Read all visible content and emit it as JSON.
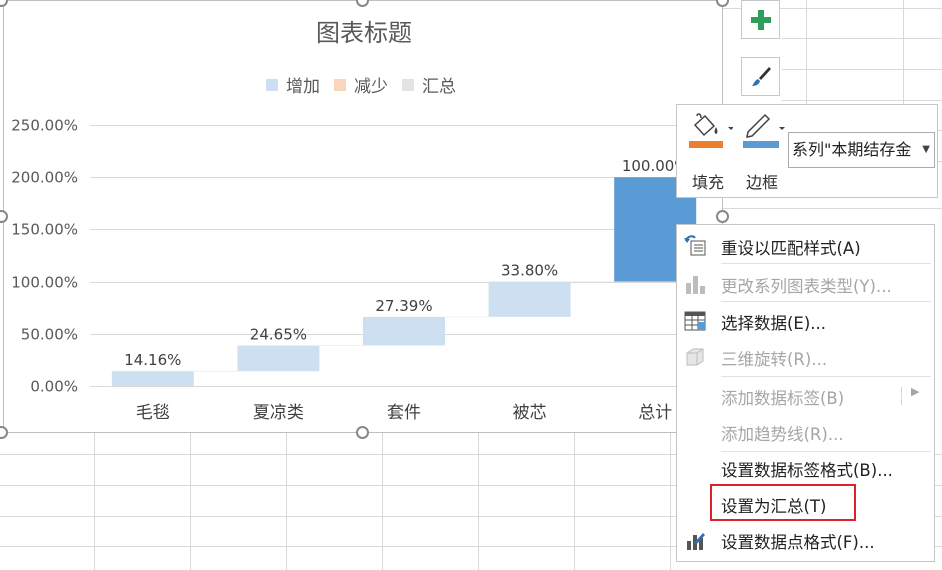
{
  "chart_data": {
    "type": "bar",
    "title": "图表标题",
    "legend": {
      "position": "top",
      "entries": [
        {
          "name": "增加",
          "color": "#CCE0F2"
        },
        {
          "name": "减少",
          "color": "#FAD5BE"
        },
        {
          "name": "汇总",
          "color": "#E3E3E3"
        }
      ]
    },
    "categories": [
      "毛毯",
      "夏凉类",
      "套件",
      "被芯",
      "总计"
    ],
    "series": [
      {
        "name": "增加",
        "bases": [
          0,
          14.16,
          38.81,
          66.2,
          0
        ],
        "values": [
          14.16,
          24.65,
          27.39,
          33.8,
          0
        ]
      },
      {
        "name": "汇总",
        "bases": [
          0,
          0,
          0,
          0,
          100
        ],
        "values": [
          0,
          0,
          0,
          0,
          100
        ]
      }
    ],
    "data_labels": [
      "14.16%",
      "24.65%",
      "27.39%",
      "33.80%",
      "100.00%"
    ],
    "y_ticks": [
      "0.00%",
      "50.00%",
      "100.00%",
      "150.00%",
      "200.00%",
      "250.00%"
    ],
    "ylim": [
      0,
      250
    ],
    "grid": true,
    "colors": {
      "increase": "#CCE0F2",
      "total_selected": "#5B9BD5"
    }
  },
  "mini_toolbar": {
    "fill_label": "填充",
    "border_label": "边框",
    "series_select_value": "系列\"本期结存金"
  },
  "side_buttons": {
    "add_icon": "plus-icon",
    "style_icon": "paintbrush-icon"
  },
  "context_menu": {
    "items": [
      {
        "label": "重设以匹配样式(A)",
        "enabled": true,
        "icon": "reset-style-icon"
      },
      {
        "label": "更改系列图表类型(Y)...",
        "enabled": false,
        "icon": "chart-type-icon"
      },
      {
        "label": "选择数据(E)...",
        "enabled": true,
        "icon": "select-data-icon"
      },
      {
        "label": "三维旋转(R)...",
        "enabled": false,
        "icon": "3d-rotate-icon"
      },
      {
        "label": "添加数据标签(B)",
        "enabled": false,
        "icon": ""
      },
      {
        "label": "添加趋势线(R)...",
        "enabled": false,
        "icon": ""
      },
      {
        "label": "设置数据标签格式(B)...",
        "enabled": true,
        "icon": ""
      },
      {
        "label": "设置为汇总(T)",
        "enabled": true,
        "icon": ""
      },
      {
        "label": "设置数据点格式(F)...",
        "enabled": true,
        "icon": "format-point-icon"
      }
    ]
  }
}
